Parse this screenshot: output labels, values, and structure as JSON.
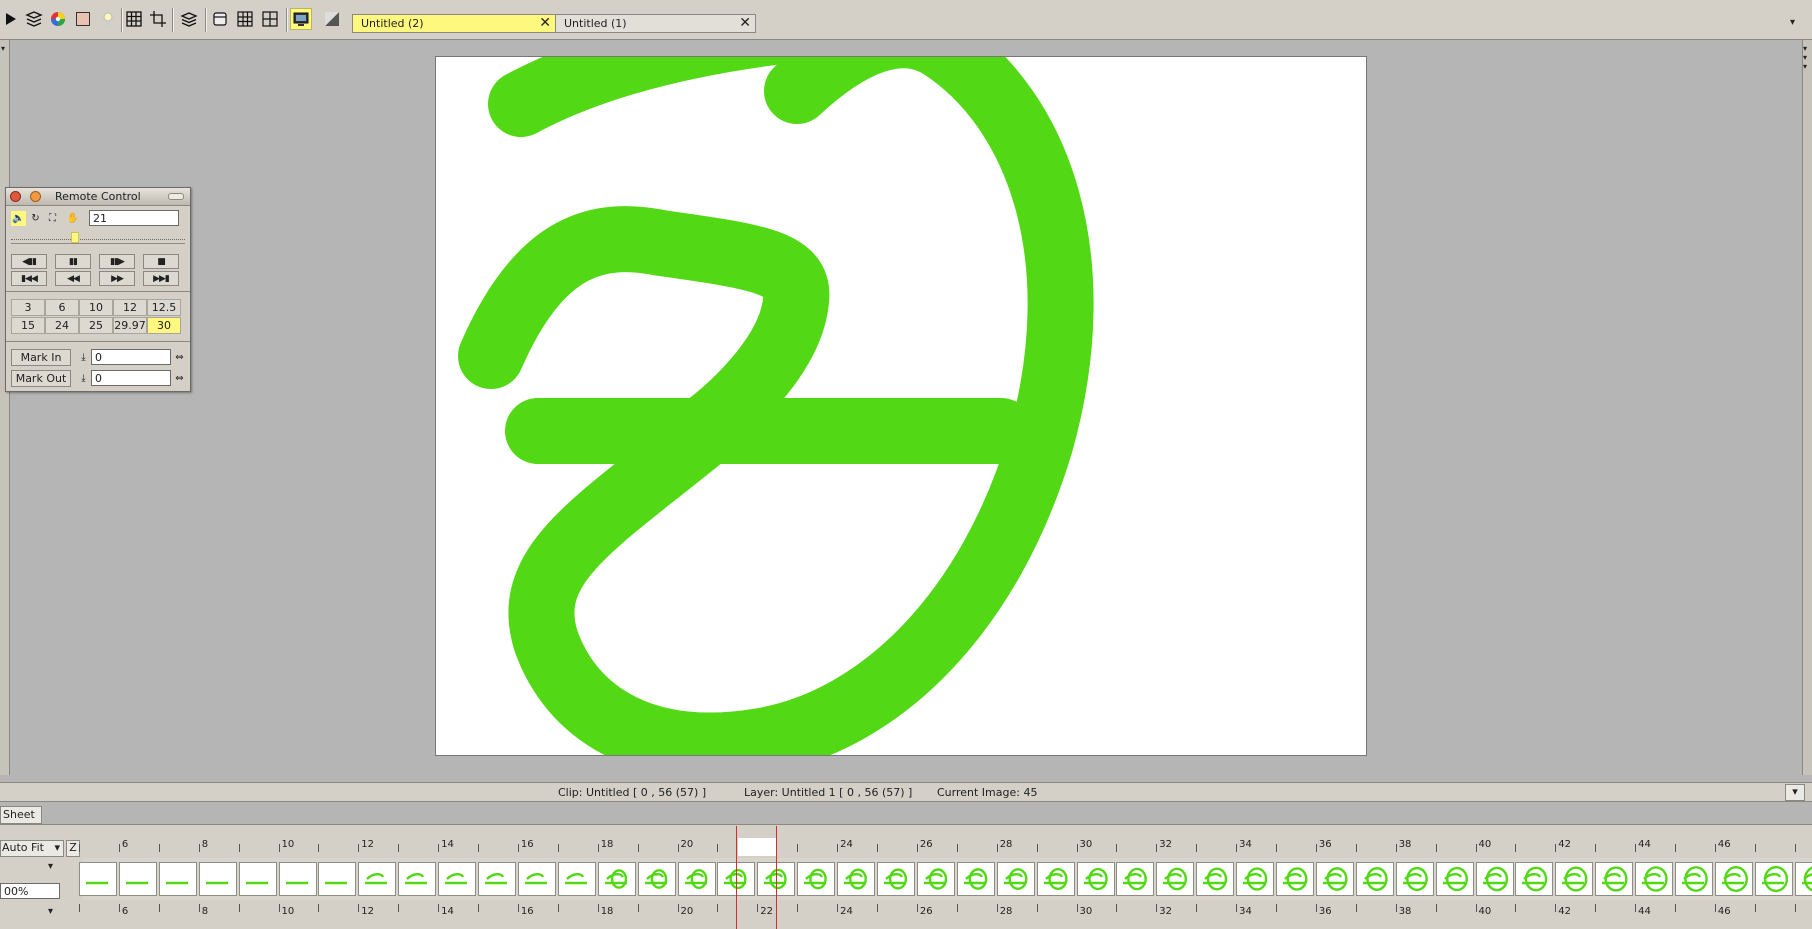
{
  "toolbar": {
    "buttons": [
      "play-icon",
      "layers-icon",
      "color-wheel-icon",
      "color-swatch-icon",
      "light-bulb-icon",
      "grid-icon",
      "crop-icon",
      "stack-icon",
      "cylinder-icon",
      "table-icon",
      "grid-plus-icon",
      "monitor-icon",
      "gradient-icon"
    ]
  },
  "tabs": [
    {
      "label": "Untitled (2)",
      "active": true
    },
    {
      "label": "Untitled (1)",
      "active": false
    }
  ],
  "remote": {
    "title": "Remote Control",
    "frame_value": "21",
    "transport_row1": [
      "◀▮▮",
      "▮▮",
      "▮▮▶",
      "■"
    ],
    "transport_row2": [
      "▮◀◀",
      "◀◀",
      "▶▶",
      "▶▶▮"
    ],
    "fps_row1": [
      "3",
      "6",
      "10",
      "12",
      "12.5"
    ],
    "fps_row2": [
      "15",
      "24",
      "25",
      "29.97",
      "30"
    ],
    "fps_selected": "30",
    "slider_position": 0.36,
    "mark_in_label": "Mark In",
    "mark_in_value": "0",
    "mark_out_label": "Mark Out",
    "mark_out_value": "0"
  },
  "status": {
    "clip": "Clip: Untitled [ 0 , 56  (57) ]",
    "layer": "Layer: Untitled 1 [ 0 , 56  (57) ]",
    "current_image": "Current Image: 45"
  },
  "xsheet": {
    "tab_label": "Sheet",
    "fit_label": "Auto Fit",
    "z_label": "Z",
    "zoom_value": "00%",
    "ruler_labels": [
      "6",
      "8",
      "10",
      "12",
      "14",
      "16",
      "18",
      "20",
      "22",
      "24",
      "26",
      "28",
      "30",
      "32",
      "34",
      "36",
      "38",
      "40",
      "42",
      "44",
      "46"
    ],
    "current_frame": 21
  },
  "colors": {
    "stroke": "#52d815",
    "highlight": "#fff87e",
    "chrome": "#d4d0c8",
    "backdrop": "#b5b5b5"
  }
}
